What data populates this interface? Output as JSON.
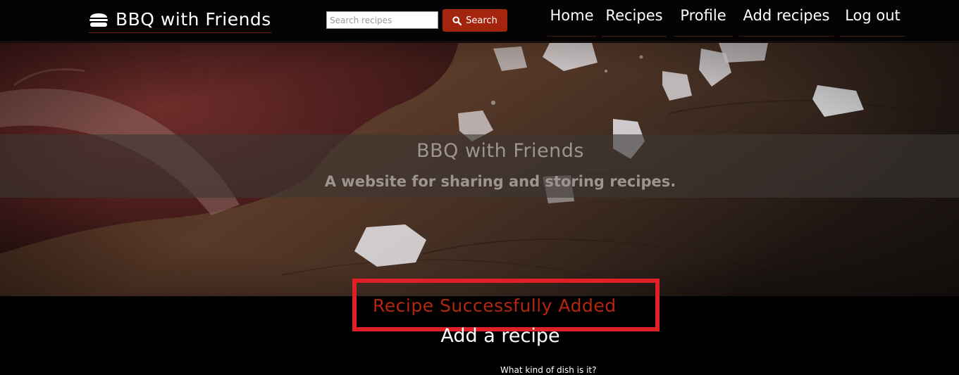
{
  "navbar": {
    "brand_label": "BBQ with Friends",
    "brand_icon": "burger-icon",
    "search": {
      "placeholder": "Search recipes",
      "value": "",
      "button_label": "Search",
      "button_icon": "search-icon"
    },
    "links": [
      {
        "label": "Home"
      },
      {
        "label": "Recipes"
      },
      {
        "label": "Profile"
      },
      {
        "label": "Add recipes"
      },
      {
        "label": "Log out"
      }
    ]
  },
  "hero": {
    "title": "BBQ with Friends",
    "subtitle": "A website for sharing and storing recipes."
  },
  "flash_message": "Recipe Successfully Added",
  "form": {
    "heading": "Add a recipe",
    "first_question": "What kind of dish is it?"
  },
  "colors": {
    "accent": "#a3250d",
    "flash_text": "#b5260f",
    "highlight_border": "#e01f26",
    "navbar_bg": "#040404",
    "page_bg": "#000000"
  }
}
